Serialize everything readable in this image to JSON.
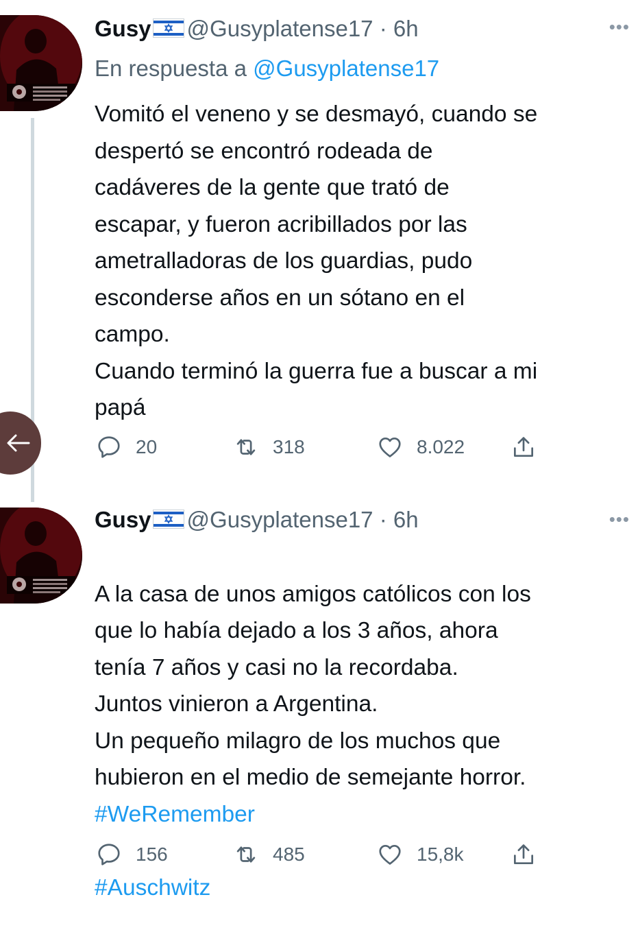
{
  "tweets": [
    {
      "name": "Gusy",
      "flag_icon": "israel-flag-icon",
      "handle": "@Gusyplatense17",
      "time": "· 6h",
      "more": "•••",
      "reply_prefix": "En respuesta a ",
      "reply_handle": "@Gusyplatense17",
      "text": "Vomitó el veneno y se desmayó, cuando se\ndespertó se encontró rodeada de\ncadáveres de la gente que trató de\nescapar, y fueron acribillados por las\nametralladoras de los guardias, pudo\nesconderse años en un sótano en el\ncampo.\nCuando terminó la guerra fue a buscar a mi\npapá",
      "replies": "20",
      "retweets": "318",
      "likes": "8.022"
    },
    {
      "name": "Gusy",
      "flag_icon": "israel-flag-icon",
      "handle": "@Gusyplatense17",
      "time": "· 6h",
      "more": "•••",
      "text": "A la casa de unos amigos católicos con los\nque lo había dejado a los 3 años, ahora\ntenía 7 años y casi no la recordaba.\nJuntos vinieron a Argentina.\nUn pequeño milagro de los muchos que\nhubieron en el medio de semejante horror.",
      "hashtags": [
        "#WeRemember",
        "#Auschwitz"
      ],
      "replies": "156",
      "retweets": "485",
      "likes": "15,8k"
    }
  ],
  "icons": {
    "reply": "reply-icon",
    "retweet": "retweet-icon",
    "like": "heart-icon",
    "share": "share-icon",
    "back": "arrow-left-icon"
  },
  "colors": {
    "link": "#1d9bf0",
    "secondary_text": "#536471",
    "thread_line": "#cfd9de",
    "back_button": "#5d3c3b"
  }
}
